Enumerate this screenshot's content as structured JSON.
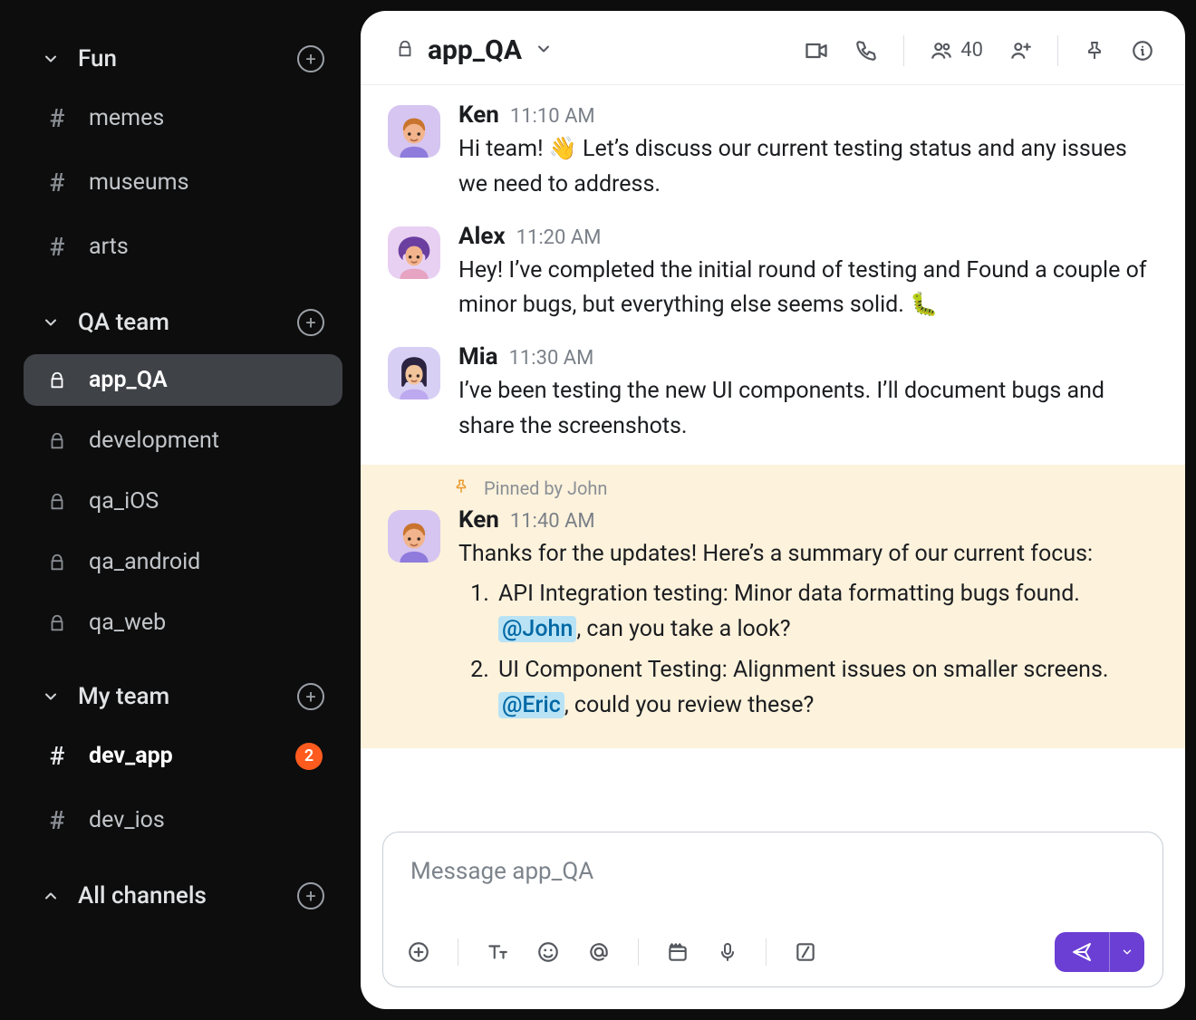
{
  "sidebar": {
    "groups": [
      {
        "title": "Fun",
        "expanded": true,
        "channels": [
          {
            "type": "hash",
            "label": "memes"
          },
          {
            "type": "hash",
            "label": "museums"
          },
          {
            "type": "hash",
            "label": "arts"
          }
        ]
      },
      {
        "title": "QA team",
        "expanded": true,
        "channels": [
          {
            "type": "lock",
            "label": "app_QA",
            "active": true
          },
          {
            "type": "lock",
            "label": "development"
          },
          {
            "type": "lock",
            "label": "qa_iOS"
          },
          {
            "type": "lock",
            "label": "qa_android"
          },
          {
            "type": "lock",
            "label": "qa_web"
          }
        ]
      },
      {
        "title": "My team",
        "expanded": true,
        "channels": [
          {
            "type": "hash",
            "label": "dev_app",
            "bold": true,
            "badge": "2"
          },
          {
            "type": "hash",
            "label": "dev_ios"
          }
        ]
      },
      {
        "title": "All channels",
        "expanded": false,
        "channels": []
      }
    ]
  },
  "header": {
    "channel_name": "app_QA",
    "member_count": "40"
  },
  "messages": [
    {
      "author": "Ken",
      "timestamp": "11:10 AM",
      "avatar": "ken",
      "text": "Hi team! 👋 Let’s discuss our current testing status and any issues we need to address."
    },
    {
      "author": "Alex",
      "timestamp": "11:20 AM",
      "avatar": "alex",
      "text": "Hey! I’ve completed the initial round of testing and Found a couple of minor bugs, but everything else seems solid. 🐛"
    },
    {
      "author": "Mia",
      "timestamp": "11:30 AM",
      "avatar": "mia",
      "text": "I’ve been testing the new UI components. I’ll document bugs and share the screenshots."
    }
  ],
  "pinned": {
    "pinned_by": "Pinned by John",
    "author": "Ken",
    "timestamp": "11:40 AM",
    "avatar": "ken",
    "intro": "Thanks for the updates! Here’s a summary of our current focus:",
    "items": [
      {
        "prefix": "API Integration testing: Minor data formatting bugs found. ",
        "mention": "@John",
        "suffix": ", can you take a look?"
      },
      {
        "prefix": "UI Component Testing: Alignment issues on smaller screens. ",
        "mention": "@Eric",
        "suffix": ", could you review these?"
      }
    ]
  },
  "composer": {
    "placeholder": "Message app_QA"
  },
  "icons": {
    "plus": "add-icon",
    "video": "video-icon",
    "phone": "phone-icon",
    "members": "members-icon",
    "add_person": "add-person-icon",
    "pin": "pin-icon",
    "info": "info-icon",
    "text_format": "text-format-icon",
    "emoji": "emoji-icon",
    "mention": "mention-icon",
    "clip": "clip-icon",
    "mic": "mic-icon",
    "slash": "slash-command-icon",
    "send": "send-icon"
  }
}
